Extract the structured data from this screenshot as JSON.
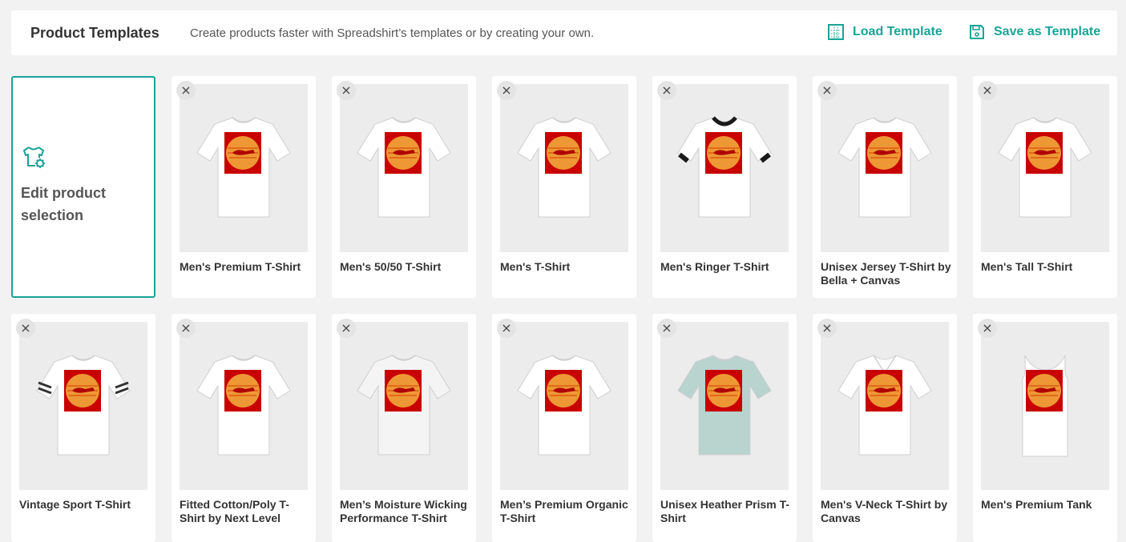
{
  "header": {
    "title": "Product Templates",
    "subtitle": "Create products faster with Spreadshirt’s templates or by creating your own.",
    "load_label": "Load Template",
    "save_label": "Save as Template",
    "accent_color": "#1aa396"
  },
  "edit_card": {
    "label": "Edit product selection",
    "icon": "shirt-gear-icon"
  },
  "remove_glyph": "×",
  "products": [
    {
      "name": "Men's Premium T-Shirt",
      "shirt": "tee",
      "color": "#ffffff"
    },
    {
      "name": "Men's 50/50 T-Shirt",
      "shirt": "tee",
      "color": "#ffffff"
    },
    {
      "name": "Men's T-Shirt",
      "shirt": "tee",
      "color": "#ffffff"
    },
    {
      "name": "Men's Ringer T-Shirt",
      "shirt": "ringer",
      "color": "#ffffff"
    },
    {
      "name": "Unisex Jersey T-Shirt by Bella + Canvas",
      "shirt": "tee",
      "color": "#ffffff"
    },
    {
      "name": "Men's Tall T-Shirt",
      "shirt": "tee",
      "color": "#ffffff"
    },
    {
      "name": "Vintage Sport T-Shirt",
      "shirt": "sport",
      "color": "#ffffff"
    },
    {
      "name": "Fitted Cotton/Poly T-Shirt by Next Level",
      "shirt": "tee",
      "color": "#ffffff"
    },
    {
      "name": "Men’s Moisture Wicking Performance T-Shirt",
      "shirt": "tee",
      "color": "#f4f4f4"
    },
    {
      "name": "Men’s Premium Organic T-Shirt",
      "shirt": "tee",
      "color": "#ffffff"
    },
    {
      "name": "Unisex Heather Prism T-Shirt",
      "shirt": "tee",
      "color": "#b9d3cf"
    },
    {
      "name": "Men's V-Neck T-Shirt by Canvas",
      "shirt": "vneck",
      "color": "#ffffff"
    },
    {
      "name": "Men's Premium Tank",
      "shirt": "tank",
      "color": "#ffffff"
    }
  ]
}
